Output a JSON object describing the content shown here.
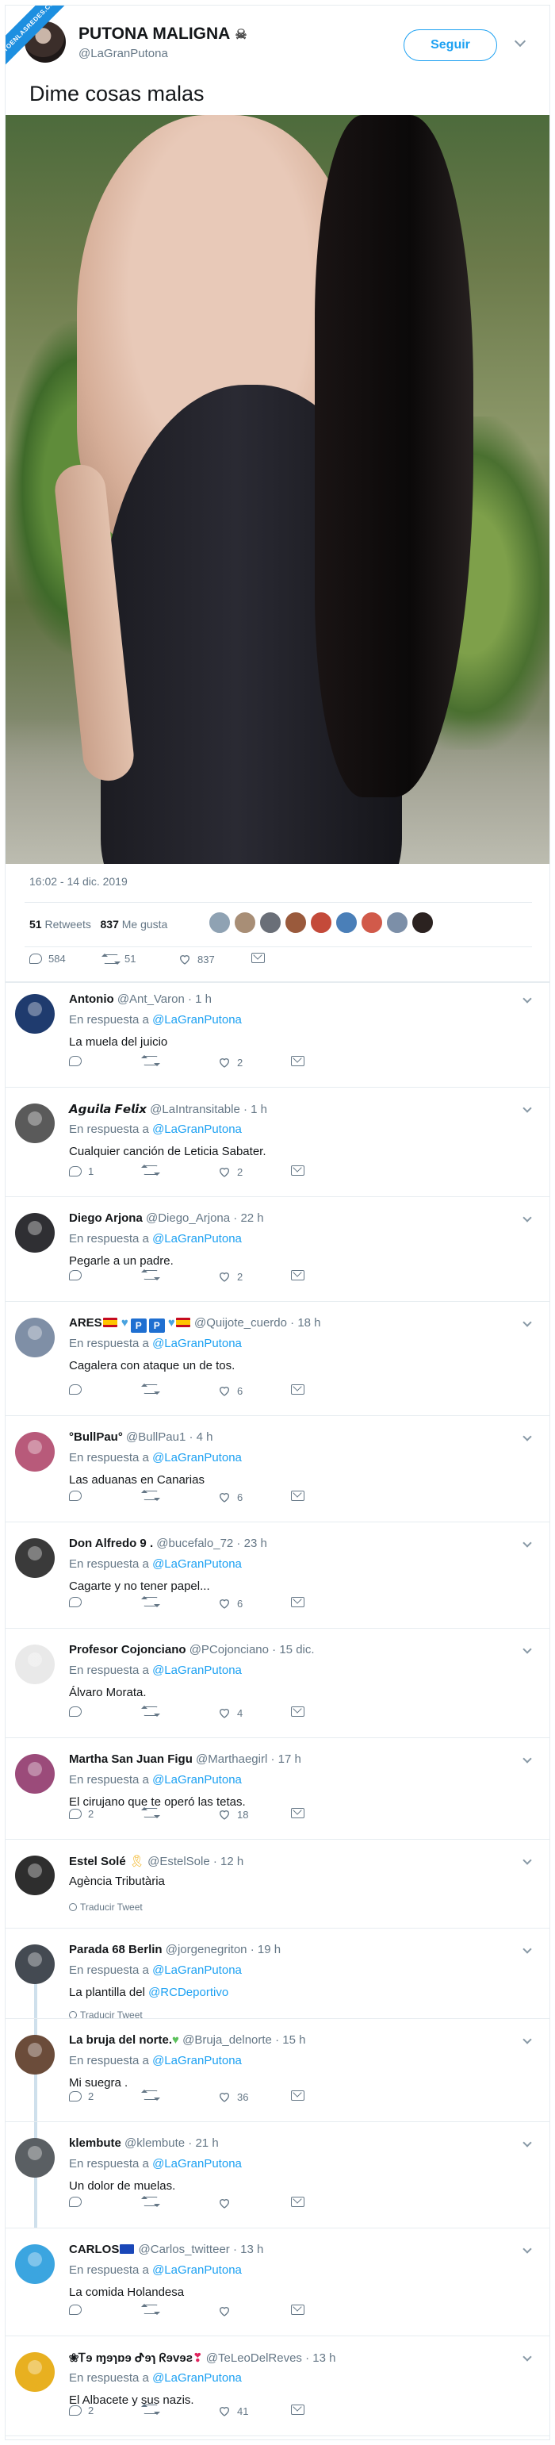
{
  "watermark": "VISTOENLASREDES.COM",
  "tweet": {
    "name": "PUTONA MALIGNA",
    "name_icon": "skull-icon",
    "handle": "@LaGranPutona",
    "follow_label": "Seguir",
    "text": "Dime cosas malas",
    "date": "16:02 - 14 dic. 2019",
    "retweets_count": "51",
    "retweets_label": "Retweets",
    "likes_count": "837",
    "likes_label": "Me gusta",
    "reply_count": "584",
    "retweet_count": "51",
    "like_count": "837"
  },
  "in_reply_prefix": "En respuesta a",
  "translate_label": "Traducir Tweet",
  "replies": [
    {
      "name": "Antonio",
      "handle": "@Ant_Varon",
      "time": "1 h",
      "to": "@LaGranPutona",
      "text": "La muela del juicio",
      "replies": "",
      "retweets": "",
      "likes": "2"
    },
    {
      "name": "𝘼𝙜𝙪𝙞𝙡𝙖 𝙁𝙚𝙡𝙞𝙭",
      "handle": "@LaIntransitable",
      "time": "1 h",
      "to": "@LaGranPutona",
      "text": "Cualquier canción de Leticia Sabater.",
      "replies": "1",
      "retweets": "",
      "likes": "2"
    },
    {
      "name": "Diego Arjona",
      "handle": "@Diego_Arjona",
      "time": "22 h",
      "to": "@LaGranPutona",
      "text": "Pegarle a un padre.",
      "replies": "",
      "retweets": "",
      "likes": "2"
    },
    {
      "name": "ARES",
      "handle": "@Quijote_cuerdo",
      "time": "18 h",
      "to": "@LaGranPutona",
      "text": "Cagalera con ataque un de tos.",
      "replies": "",
      "retweets": "",
      "likes": "6",
      "pp": "P"
    },
    {
      "name": "°BullPau°",
      "handle": "@BullPau1",
      "time": "4 h",
      "to": "@LaGranPutona",
      "text": "Las aduanas en Canarias",
      "replies": "",
      "retweets": "",
      "likes": "6"
    },
    {
      "name": "Don Alfredo 9 .",
      "handle": "@bucefalo_72",
      "time": "23 h",
      "to": "@LaGranPutona",
      "text": "Cagarte y no tener papel...",
      "replies": "",
      "retweets": "",
      "likes": "6"
    },
    {
      "name": "Profesor Cojonciano",
      "handle": "@PCojonciano",
      "time": "15 dic.",
      "to": "@LaGranPutona",
      "text": "Álvaro Morata.",
      "replies": "",
      "retweets": "",
      "likes": "4"
    },
    {
      "name": "Martha San Juan Figu",
      "handle": "@Marthaegirl",
      "time": "17 h",
      "to": "@LaGranPutona",
      "text": "El cirujano que te operó las tetas.",
      "replies": "2",
      "retweets": "",
      "likes": "18"
    },
    {
      "name": "Estel Solé",
      "handle": "@EstelSole",
      "time": "12 h",
      "to": "",
      "text": "Agència Tributària",
      "replies": "",
      "retweets": "",
      "likes": ""
    },
    {
      "name": "Parada 68 Berlin",
      "handle": "@jorgenegriton",
      "time": "19 h",
      "to": "@LaGranPutona",
      "text": "La plantilla del",
      "mention": "@RCDeportivo",
      "replies": "",
      "retweets": "",
      "likes": ""
    },
    {
      "name": "La bruja del norte.",
      "handle": "@Bruja_delnorte",
      "time": "15 h",
      "to": "@LaGranPutona",
      "text": "Mi suegra .",
      "replies": "2",
      "retweets": "",
      "likes": "36"
    },
    {
      "name": "klembute",
      "handle": "@klembute",
      "time": "21 h",
      "to": "@LaGranPutona",
      "text": "Un dolor de muelas.",
      "replies": "",
      "retweets": "",
      "likes": ""
    },
    {
      "name": "CARLOS",
      "handle": "@Carlos_twitteer",
      "time": "13 h",
      "to": "@LaGranPutona",
      "text": "La comida Holandesa",
      "replies": "",
      "retweets": "",
      "likes": ""
    },
    {
      "name": "❀Ꭲɘ ɱɘɿɒɘ ᕷɘɿ ᖇɘvɘƨ",
      "handle": "@TeLeoDelReves",
      "time": "13 h",
      "to": "@LaGranPutona",
      "text": "El Albacete y sus nazis.",
      "replies": "2",
      "retweets": "",
      "likes": "41"
    }
  ],
  "colors": {
    "accent": "#1da1f2",
    "text": "#14171a",
    "muted": "#657786",
    "watermark": "#1d8fe0"
  }
}
